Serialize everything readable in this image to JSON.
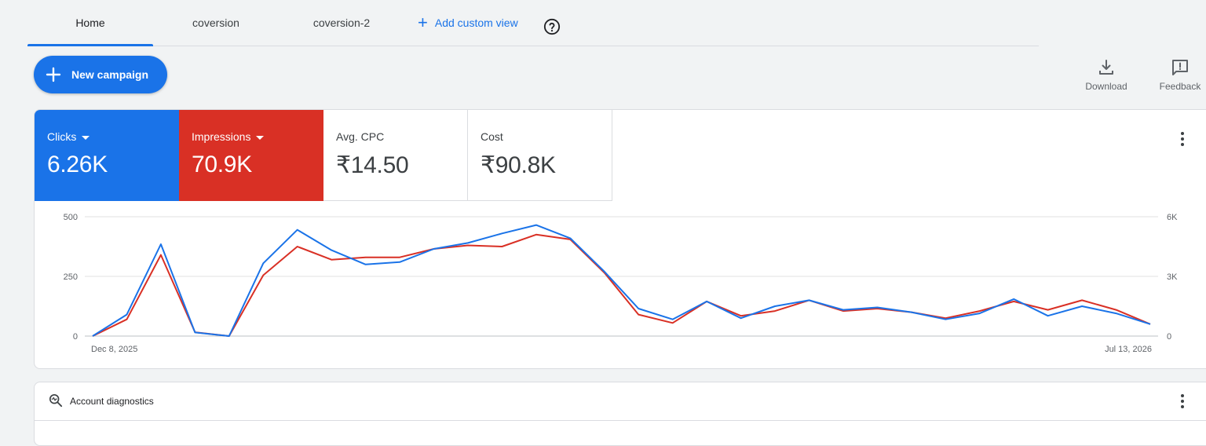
{
  "tabs": [
    {
      "label": "Home",
      "active": true
    },
    {
      "label": "coversion",
      "active": false
    },
    {
      "label": "coversion-2",
      "active": false
    }
  ],
  "add_view_label": "Add custom view",
  "new_campaign_label": "New campaign",
  "tools": {
    "download": "Download",
    "feedback": "Feedback"
  },
  "metrics": {
    "clicks": {
      "label": "Clicks",
      "value": "6.26K"
    },
    "impressions": {
      "label": "Impressions",
      "value": "70.9K"
    },
    "avg_cpc": {
      "label": "Avg. CPC",
      "value": "₹14.50"
    },
    "cost": {
      "label": "Cost",
      "value": "₹90.8K"
    }
  },
  "colors": {
    "clicks": "#1a73e8",
    "impressions": "#d93025"
  },
  "diagnostics": {
    "title": "Account diagnostics"
  },
  "chart_data": {
    "type": "line",
    "x_labels": [
      "Dec 8, 2025",
      "Jul 13, 2026"
    ],
    "y_left_ticks": [
      "0",
      "250",
      "500"
    ],
    "y_right_ticks": [
      "0",
      "3K",
      "6K"
    ],
    "y_left_range": [
      0,
      500
    ],
    "y_right_range": [
      0,
      6000
    ],
    "grid": true,
    "series": [
      {
        "name": "Clicks",
        "axis": "left",
        "color": "#1a73e8",
        "values": [
          0,
          90,
          385,
          15,
          0,
          305,
          445,
          360,
          300,
          310,
          365,
          390,
          430,
          465,
          410,
          270,
          115,
          70,
          145,
          75,
          125,
          150,
          110,
          120,
          100,
          70,
          95,
          155,
          85,
          125,
          95,
          50
        ]
      },
      {
        "name": "Impressions",
        "axis": "right",
        "color": "#d93025",
        "values": [
          0,
          840,
          4080,
          192,
          0,
          3060,
          4500,
          3840,
          3960,
          3960,
          4380,
          4560,
          4500,
          5100,
          4860,
          3180,
          1080,
          660,
          1740,
          1020,
          1260,
          1800,
          1260,
          1380,
          1200,
          900,
          1260,
          1740,
          1320,
          1800,
          1320,
          600
        ]
      }
    ]
  }
}
